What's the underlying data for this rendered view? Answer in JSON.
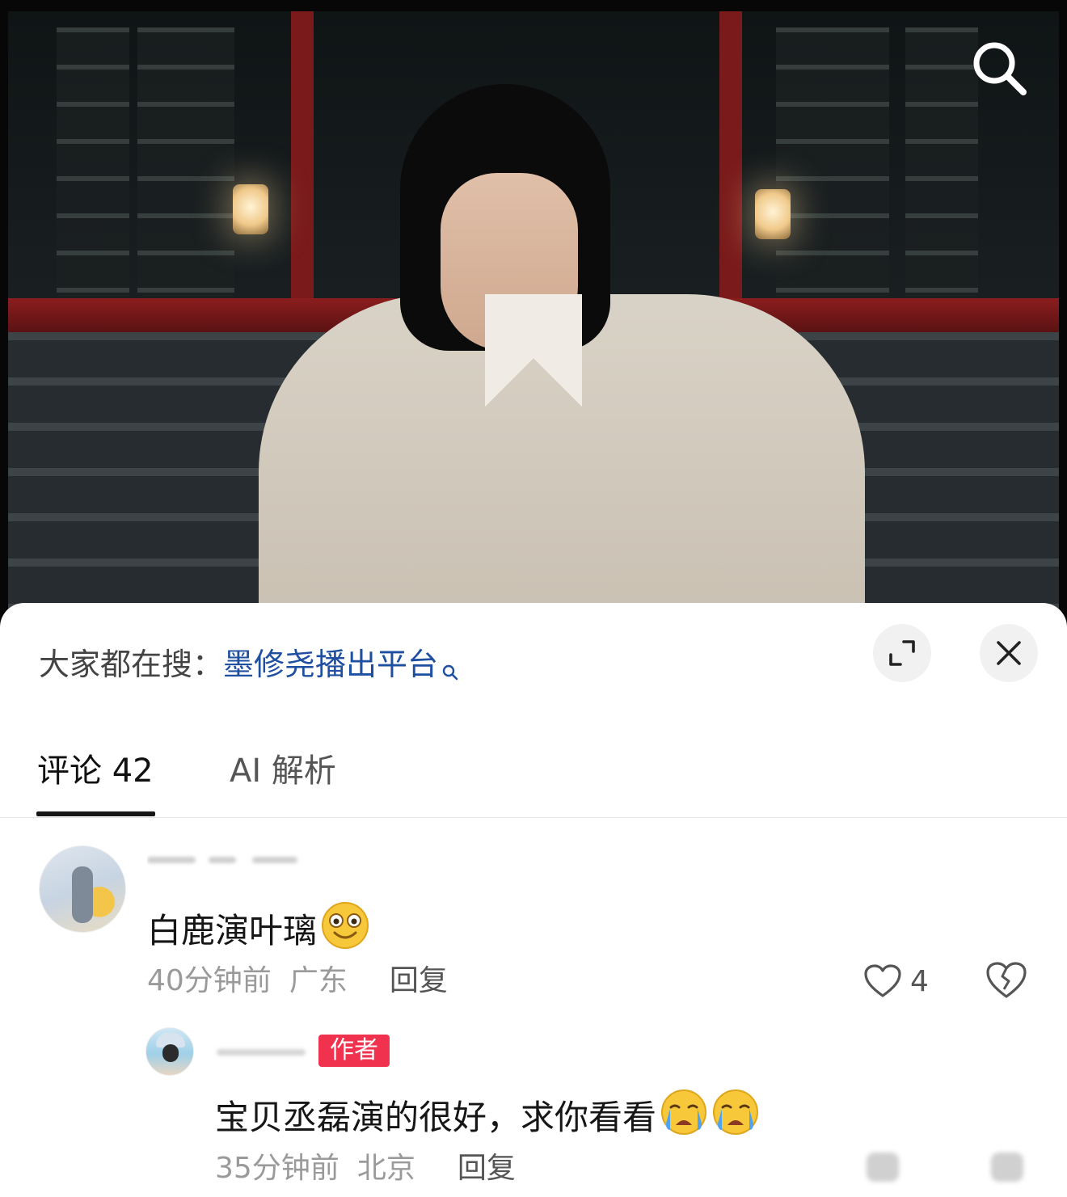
{
  "hot_search": {
    "prefix": "大家都在搜：",
    "query": "墨修尧播出平台"
  },
  "tabs": [
    {
      "label": "评论 42",
      "active": true
    },
    {
      "label": "AI 解析",
      "active": false
    }
  ],
  "comments": [
    {
      "text": "白鹿演叶璃",
      "emoji": "smiling-face",
      "time": "40分钟前",
      "location": "广东",
      "reply_label": "回复",
      "likes": "4"
    }
  ],
  "replies": [
    {
      "badge": "作者",
      "text": "宝贝丞磊演的很好，求你看看",
      "emoji": "loudly-crying-face",
      "time": "35分钟前",
      "location": "北京",
      "reply_label": "回复"
    }
  ],
  "colors": {
    "link": "#1e4fa1",
    "badge": "#f0324e",
    "meta": "#9a9a9a"
  }
}
